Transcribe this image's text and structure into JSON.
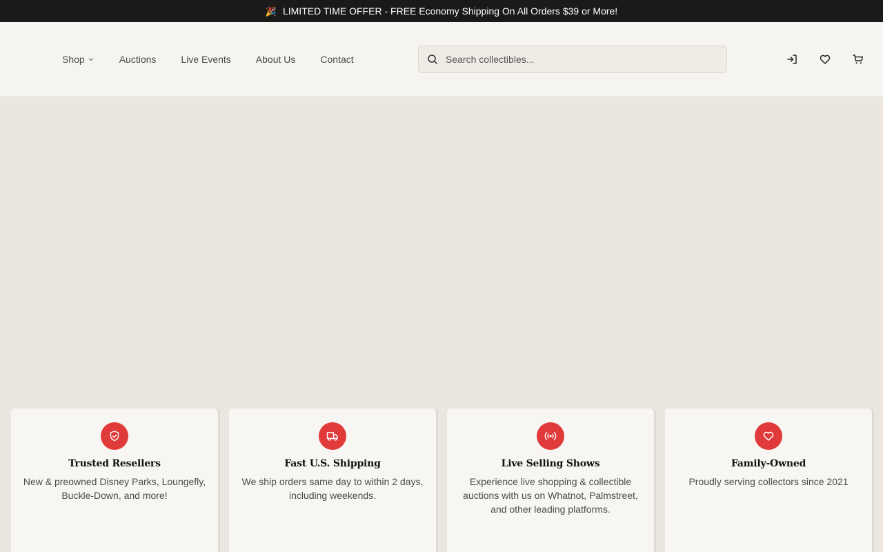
{
  "promo": {
    "icon": "party-popper-icon",
    "text": "LIMITED TIME OFFER - FREE Economy Shipping On All Orders $39 or More!"
  },
  "nav": {
    "items": [
      {
        "label": "Shop",
        "has_dropdown": true
      },
      {
        "label": "Auctions"
      },
      {
        "label": "Live Events"
      },
      {
        "label": "About Us"
      },
      {
        "label": "Contact"
      }
    ]
  },
  "search": {
    "placeholder": "Search collectibles...",
    "value": ""
  },
  "header_icons": [
    "sign-in-icon",
    "heart-icon",
    "cart-icon"
  ],
  "features": [
    {
      "icon": "shield-check-icon",
      "title": "Trusted Resellers",
      "text": "New & preowned Disney Parks, Loungefly, Buckle-Down, and more!"
    },
    {
      "icon": "truck-icon",
      "title": "Fast U.S. Shipping",
      "text": "We ship orders same day to within 2 days, including weekends."
    },
    {
      "icon": "broadcast-icon",
      "title": "Live Selling Shows",
      "text": "Experience live shopping & collectible auctions with us on Whatnot, Palmstreet, and other leading platforms."
    },
    {
      "icon": "heart-icon",
      "title": "Family-Owned",
      "text": "Proudly serving collectors since 2021"
    }
  ],
  "colors": {
    "accent": "#e03a3a",
    "promo_bg": "#1a1a1a",
    "header_bg": "#f6f4f0",
    "page_bg": "#ebe6e0",
    "card_bg": "#f8f6f2"
  }
}
